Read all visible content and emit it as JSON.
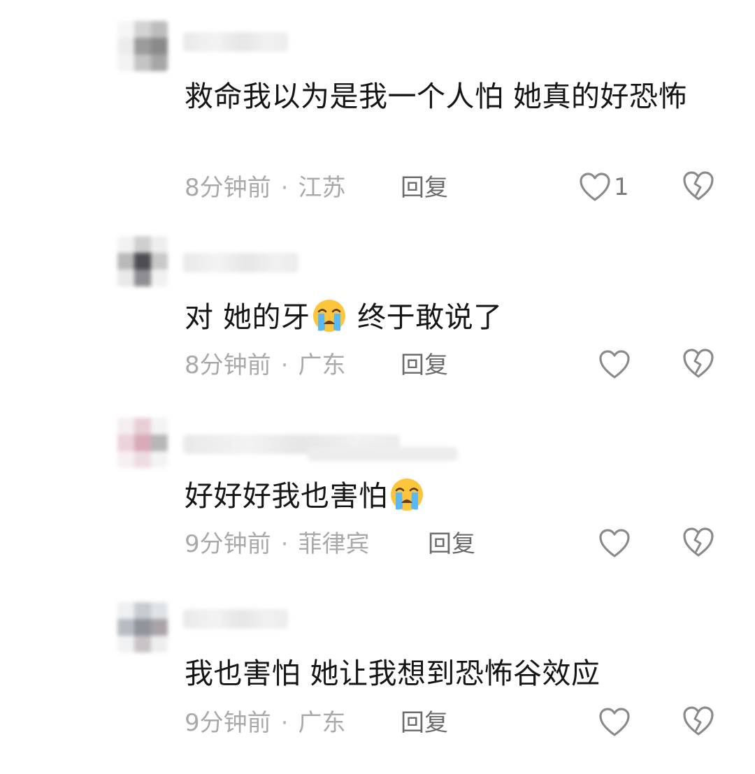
{
  "comments": [
    {
      "text": "救命我以为是我一个人怕 她真的好恐怖",
      "time": "8分钟前",
      "location": "江苏",
      "reply_label": "回复",
      "like_count": "1"
    },
    {
      "text_before": "对 她的牙",
      "text_after": " 终于敢说了",
      "emoji": "loudly-crying-face",
      "time": "8分钟前",
      "location": "广东",
      "reply_label": "回复"
    },
    {
      "text_before": "好好好我也害怕",
      "emoji": "loudly-crying-face",
      "time": "9分钟前",
      "location": "菲律宾",
      "reply_label": "回复"
    },
    {
      "text": "我也害怕 她让我想到恐怖谷效应",
      "time": "9分钟前",
      "location": "广东",
      "reply_label": "回复"
    }
  ],
  "icons": {
    "like": "heart-outline-icon",
    "dislike": "broken-heart-icon"
  },
  "colors": {
    "text": "#161616",
    "meta": "#a9a9a9",
    "reply": "#6b6b6b",
    "icon": "#8a8a8a"
  }
}
